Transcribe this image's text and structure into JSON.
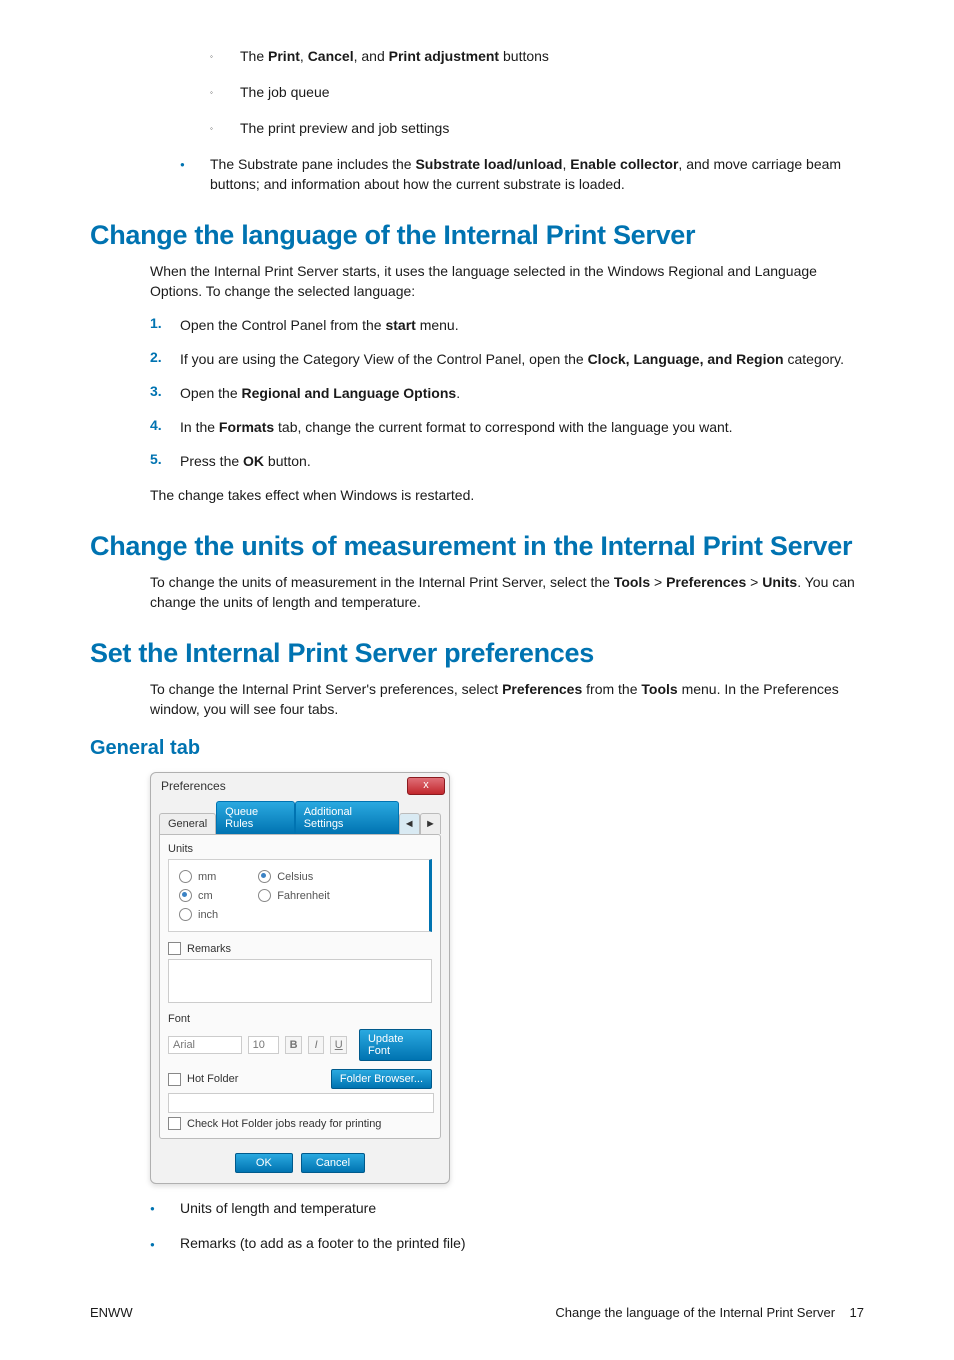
{
  "intro": {
    "sub_bullets": [
      {
        "before": "The ",
        "bolds": [
          "Print",
          "Cancel",
          "Print adjustment"
        ],
        "joins": [
          ", ",
          ", and "
        ],
        "after": " buttons"
      },
      {
        "text": "The job queue"
      },
      {
        "text": "The print preview and job settings"
      }
    ],
    "main_bullet": {
      "before": "The Substrate pane includes the ",
      "b1": "Substrate load/unload",
      "mid1": ", ",
      "b2": "Enable collector",
      "after": ", and move carriage beam buttons; and information about how the current substrate is loaded."
    }
  },
  "section1": {
    "heading": "Change the language of the Internal Print Server",
    "intro": "When the Internal Print Server starts, it uses the language selected in the Windows Regional and Language Options. To change the selected language:",
    "steps": [
      {
        "n": "1.",
        "before": "Open the Control Panel from the ",
        "b": "start",
        "after": " menu."
      },
      {
        "n": "2.",
        "before": "If you are using the Category View of the Control Panel, open the ",
        "b": "Clock, Language, and Region",
        "after": " category."
      },
      {
        "n": "3.",
        "before": "Open the ",
        "b": "Regional and Language Options",
        "after": "."
      },
      {
        "n": "4.",
        "before": "In the ",
        "b": "Formats",
        "after": " tab, change the current format to correspond with the language you want."
      },
      {
        "n": "5.",
        "before": "Press the ",
        "b": "OK",
        "after": " button."
      }
    ],
    "outro": "The change takes effect when Windows is restarted."
  },
  "section2": {
    "heading": "Change the units of measurement in the Internal Print Server",
    "before": "To change the units of measurement in the Internal Print Server, select the ",
    "b1": "Tools",
    "gt1": " > ",
    "b2": "Preferences",
    "gt2": " > ",
    "b3": "Units",
    "after": ". You can change the units of length and temperature."
  },
  "section3": {
    "heading": "Set the Internal Print Server preferences",
    "before": "To change the Internal Print Server's preferences, select ",
    "b1": "Preferences",
    "mid": " from the ",
    "b2": "Tools",
    "after": " menu. In the Preferences window, you will see four tabs.",
    "subheading": "General tab",
    "bullets": [
      "Units of length and temperature",
      "Remarks (to add as a footer to the printed file)"
    ]
  },
  "dialog": {
    "title": "Preferences",
    "close": "x",
    "tabs": {
      "general": "General",
      "queue": "Queue Rules",
      "additional": "Additional Settings",
      "nav_l": "◄",
      "nav_r": "►"
    },
    "units_label": "Units",
    "radios_len": {
      "mm": "mm",
      "cm": "cm",
      "inch": "inch"
    },
    "radios_temp": {
      "c": "Celsius",
      "f": "Fahrenheit"
    },
    "remarks": "Remarks",
    "font_label": "Font",
    "font_name": "Arial",
    "font_size": "10",
    "fmt_b": "B",
    "fmt_i": "I",
    "fmt_u": "U",
    "update_font": "Update Font",
    "hot_folder": "Hot Folder",
    "folder_browser": "Folder Browser...",
    "check_hot": "Check Hot Folder jobs ready for printing",
    "ok": "OK",
    "cancel": "Cancel"
  },
  "footer": {
    "left": "ENWW",
    "right_text": "Change the language of the Internal Print Server",
    "page": "17"
  }
}
